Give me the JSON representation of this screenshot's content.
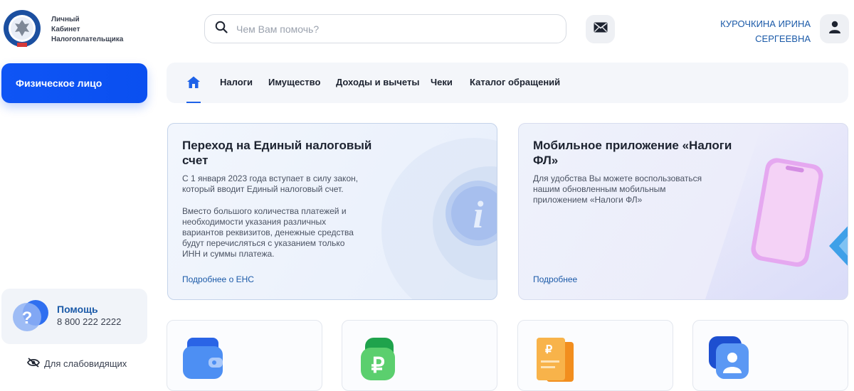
{
  "header": {
    "brand_line1": "Личный",
    "brand_line2": "Кабинет",
    "brand_line3": "Налогоплательщика",
    "search_placeholder": "Чем Вам помочь?",
    "user_name_line1": "КУРОЧКИНА ИРИНА",
    "user_name_line2": "СЕРГЕЕВНА"
  },
  "sidebar": {
    "person_type": "Физическое лицо",
    "help_title": "Помощь",
    "help_phone": "8 800 222 2222",
    "accessibility": "Для слабовидящих"
  },
  "nav": {
    "items": [
      "Налоги",
      "Имущество",
      "Доходы и вычеты",
      "Чеки",
      "Каталог обращений"
    ]
  },
  "cards": {
    "ens": {
      "title": "Переход на Единый налоговый счет",
      "text1": "С 1 января 2023 года вступает в силу закон, который вводит Единый налоговый счет.",
      "text2": "Вместо большого количества платежей и необходимости указания различных вариантов реквизитов, денежные средства будут перечисляться с указанием только ИНН и суммы платежа.",
      "link": "Подробнее о ЕНС"
    },
    "app": {
      "title": "Мобильное приложение «Налоги ФЛ»",
      "text": "Для удобства Вы можете воспользоваться нашим обновленным мобильным приложением «Налоги ФЛ»",
      "link": "Подробнее"
    }
  },
  "colors": {
    "accent": "#0f55f5",
    "link": "#1b5aa8",
    "nav_bg": "#f4f6fa"
  },
  "icons": [
    "search-icon",
    "mail-icon",
    "user-icon",
    "home-icon",
    "question-icon",
    "eye-off-icon",
    "info-icon",
    "wallet-icon",
    "ruble-icon",
    "receipt-icon",
    "profile-card-icon"
  ]
}
